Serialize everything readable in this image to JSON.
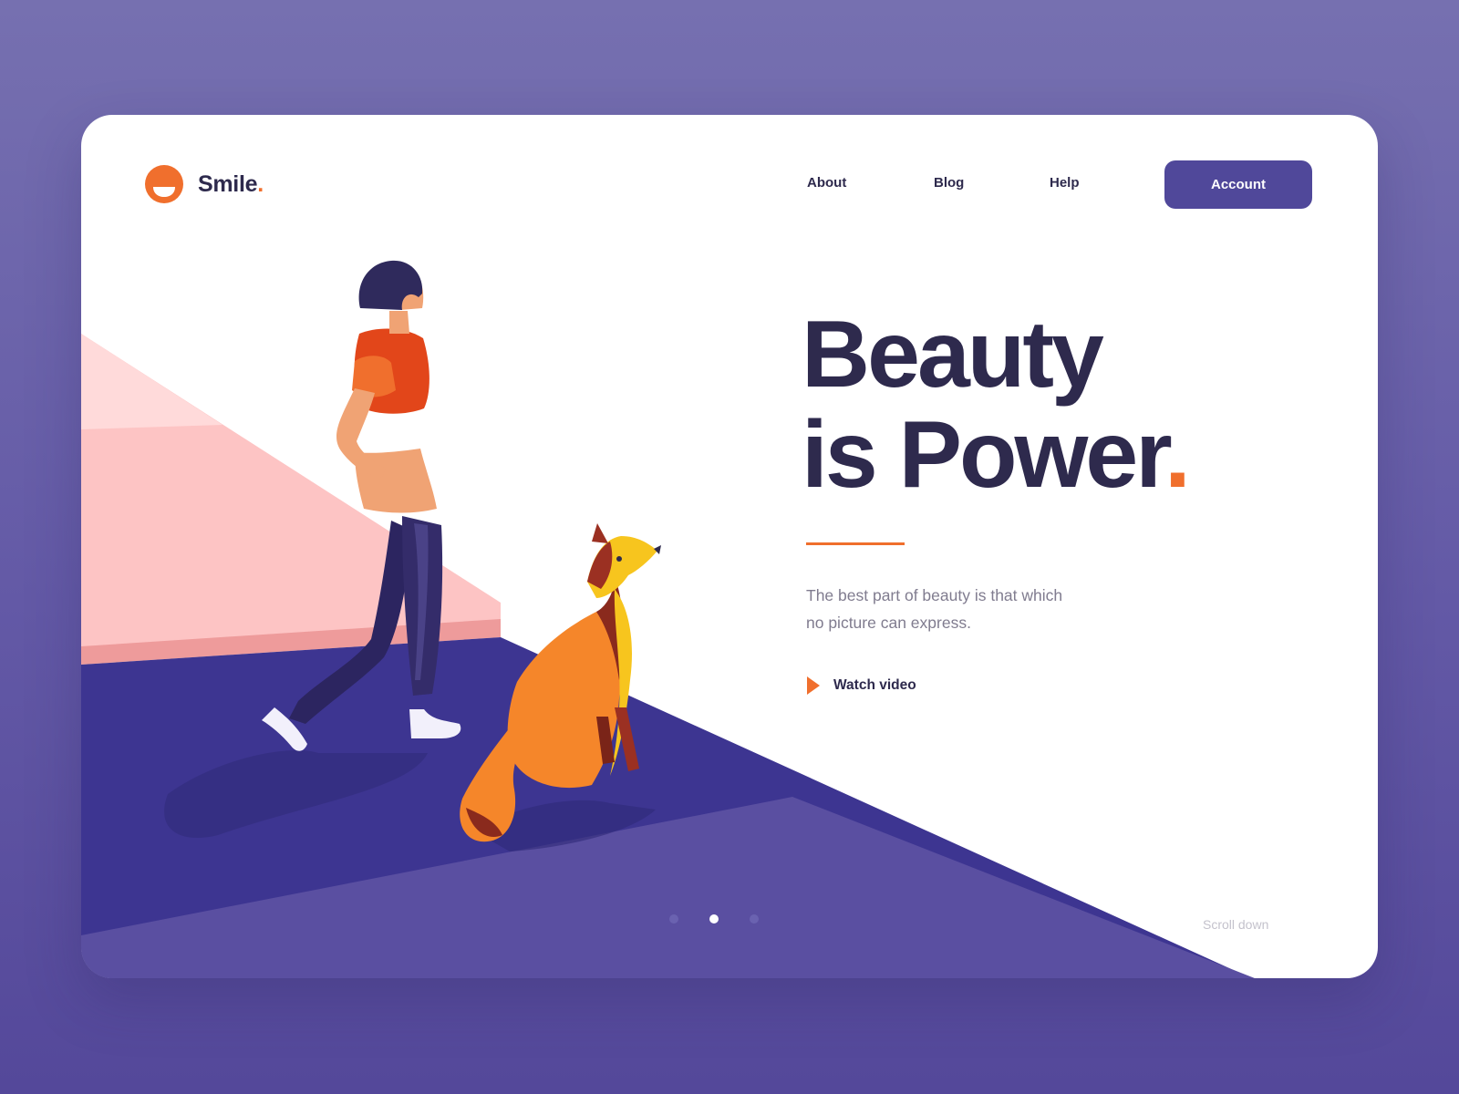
{
  "brand": {
    "name": "Smile",
    "dot": ".",
    "accent_color": "#f06f2d",
    "primary_color": "#50489a",
    "text_color": "#2e2a4d",
    "logo_icon": "smile-logo-icon"
  },
  "nav": {
    "items": [
      "About",
      "Blog",
      "Help"
    ],
    "account_label": "Account"
  },
  "hero": {
    "title_line1": "Beauty",
    "title_line2": "is Power",
    "title_dot": ".",
    "subtitle_line1": "The best part of beauty is that which",
    "subtitle_line2": "no picture can express.",
    "cta_label": "Watch video",
    "cta_icon": "play-icon"
  },
  "pager": {
    "count": 3,
    "active_index": 1
  },
  "scroll_label": "Scroll down"
}
